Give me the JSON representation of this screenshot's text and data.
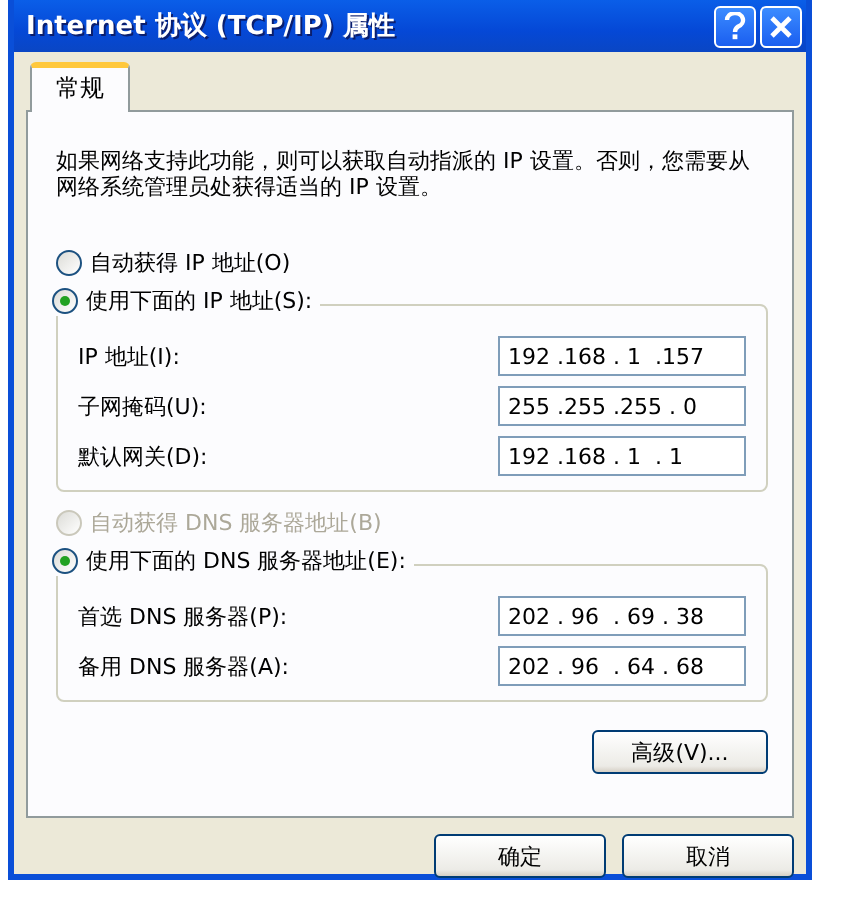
{
  "window": {
    "title": "Internet 协议 (TCP/IP) 属性"
  },
  "tabs": [
    {
      "label": "常规",
      "selected": true
    }
  ],
  "description": "如果网络支持此功能，则可以获取自动指派的 IP 设置。否则，您需要从网络系统管理员处获得适当的 IP 设置。",
  "ip_options": [
    {
      "label": "自动获得 IP 地址(O)",
      "selected": false,
      "disabled": false
    },
    {
      "label": "使用下面的 IP 地址(S):",
      "selected": true,
      "disabled": false
    }
  ],
  "ip_fields": [
    {
      "label": "IP 地址(I):",
      "value": "192 .168 . 1  .157"
    },
    {
      "label": "子网掩码(U):",
      "value": "255 .255 .255 . 0"
    },
    {
      "label": "默认网关(D):",
      "value": "192 .168 . 1  . 1"
    }
  ],
  "dns_options": [
    {
      "label": "自动获得 DNS 服务器地址(B)",
      "selected": false,
      "disabled": true
    },
    {
      "label": "使用下面的 DNS 服务器地址(E):",
      "selected": true,
      "disabled": false
    }
  ],
  "dns_fields": [
    {
      "label": "首选 DNS 服务器(P):",
      "value": "202 . 96  . 69 . 38"
    },
    {
      "label": "备用 DNS 服务器(A):",
      "value": "202 . 96  . 64 . 68"
    }
  ],
  "advanced_button": "高级(V)...",
  "buttons": [
    "确定",
    "取消"
  ]
}
